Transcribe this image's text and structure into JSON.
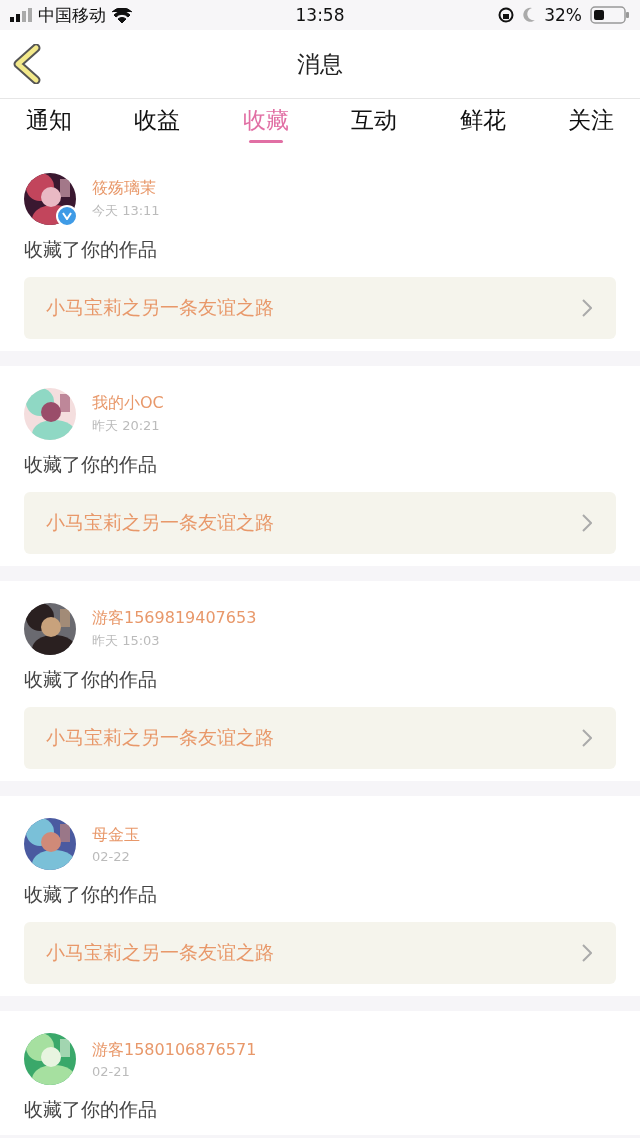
{
  "status_bar": {
    "carrier": "中国移动",
    "time": "13:58",
    "battery": "32%"
  },
  "header": {
    "title": "消息"
  },
  "tabs": [
    {
      "label": "通知",
      "selected": false
    },
    {
      "label": "收益",
      "selected": false
    },
    {
      "label": "收藏",
      "selected": true
    },
    {
      "label": "互动",
      "selected": false
    },
    {
      "label": "鲜花",
      "selected": false
    },
    {
      "label": "关注",
      "selected": false
    }
  ],
  "messages": [
    {
      "user": "筱殇璃茉",
      "verified": true,
      "time": "今天 13:11",
      "action": "收藏了你的作品",
      "work": "小马宝莉之另一条友谊之路"
    },
    {
      "user": "我的小OC",
      "verified": false,
      "time": "昨天 20:21",
      "action": "收藏了你的作品",
      "work": "小马宝莉之另一条友谊之路"
    },
    {
      "user": "游客1569819407653",
      "verified": false,
      "time": "昨天 15:03",
      "action": "收藏了你的作品",
      "work": "小马宝莉之另一条友谊之路"
    },
    {
      "user": "母金玉",
      "verified": false,
      "time": "02-22",
      "action": "收藏了你的作品",
      "work": "小马宝莉之另一条友谊之路"
    },
    {
      "user": "游客1580106876571",
      "verified": false,
      "time": "02-21",
      "action": "收藏了你的作品"
    }
  ]
}
